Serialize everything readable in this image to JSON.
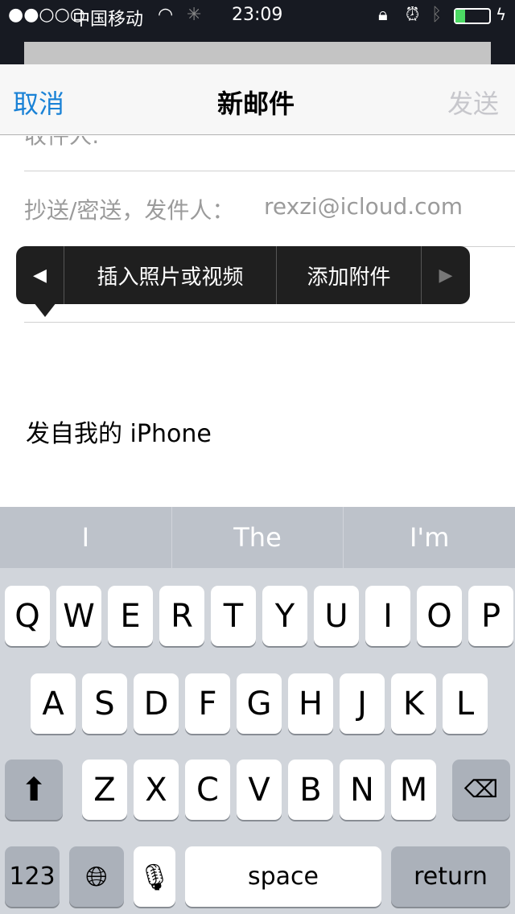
{
  "status": {
    "signal": "●●○○○",
    "carrier": "中国移动",
    "time": "23:09",
    "colors": {
      "battery": "#4cd964"
    }
  },
  "nav": {
    "cancel": "取消",
    "title": "新邮件",
    "send": "发送",
    "accent": "#1a82d6"
  },
  "compose": {
    "to_label_partial": "收件人:",
    "cc_label": "抄送/密送，发件人：",
    "from_value": "rexzi@icloud.com",
    "signature": "发自我的 iPhone"
  },
  "menu": {
    "prev": "◀",
    "insert_media": "插入照片或视频",
    "add_attachment": "添加附件",
    "next": "▶"
  },
  "keyboard": {
    "suggestions": [
      "I",
      "The",
      "I'm"
    ],
    "row1": [
      "Q",
      "W",
      "E",
      "R",
      "T",
      "Y",
      "U",
      "I",
      "O",
      "P"
    ],
    "row2": [
      "A",
      "S",
      "D",
      "F",
      "G",
      "H",
      "J",
      "K",
      "L"
    ],
    "row3": [
      "Z",
      "X",
      "C",
      "V",
      "B",
      "N",
      "M"
    ],
    "numbers": "123",
    "space": "space",
    "return": "return"
  }
}
